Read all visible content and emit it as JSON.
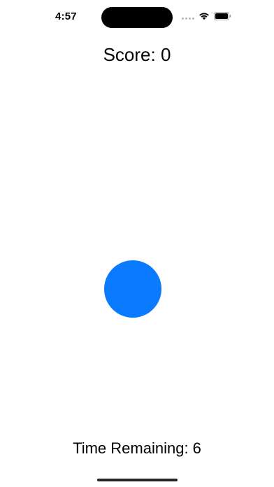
{
  "status_bar": {
    "time": "4:57",
    "icons": [
      "cellular-dots-icon",
      "wifi-icon",
      "battery-icon"
    ]
  },
  "game": {
    "score_text": "Score: 0",
    "time_remaining_text": "Time Remaining: 6"
  },
  "colors": {
    "target": "#0a7bff",
    "text": "#000000",
    "background": "#ffffff"
  }
}
